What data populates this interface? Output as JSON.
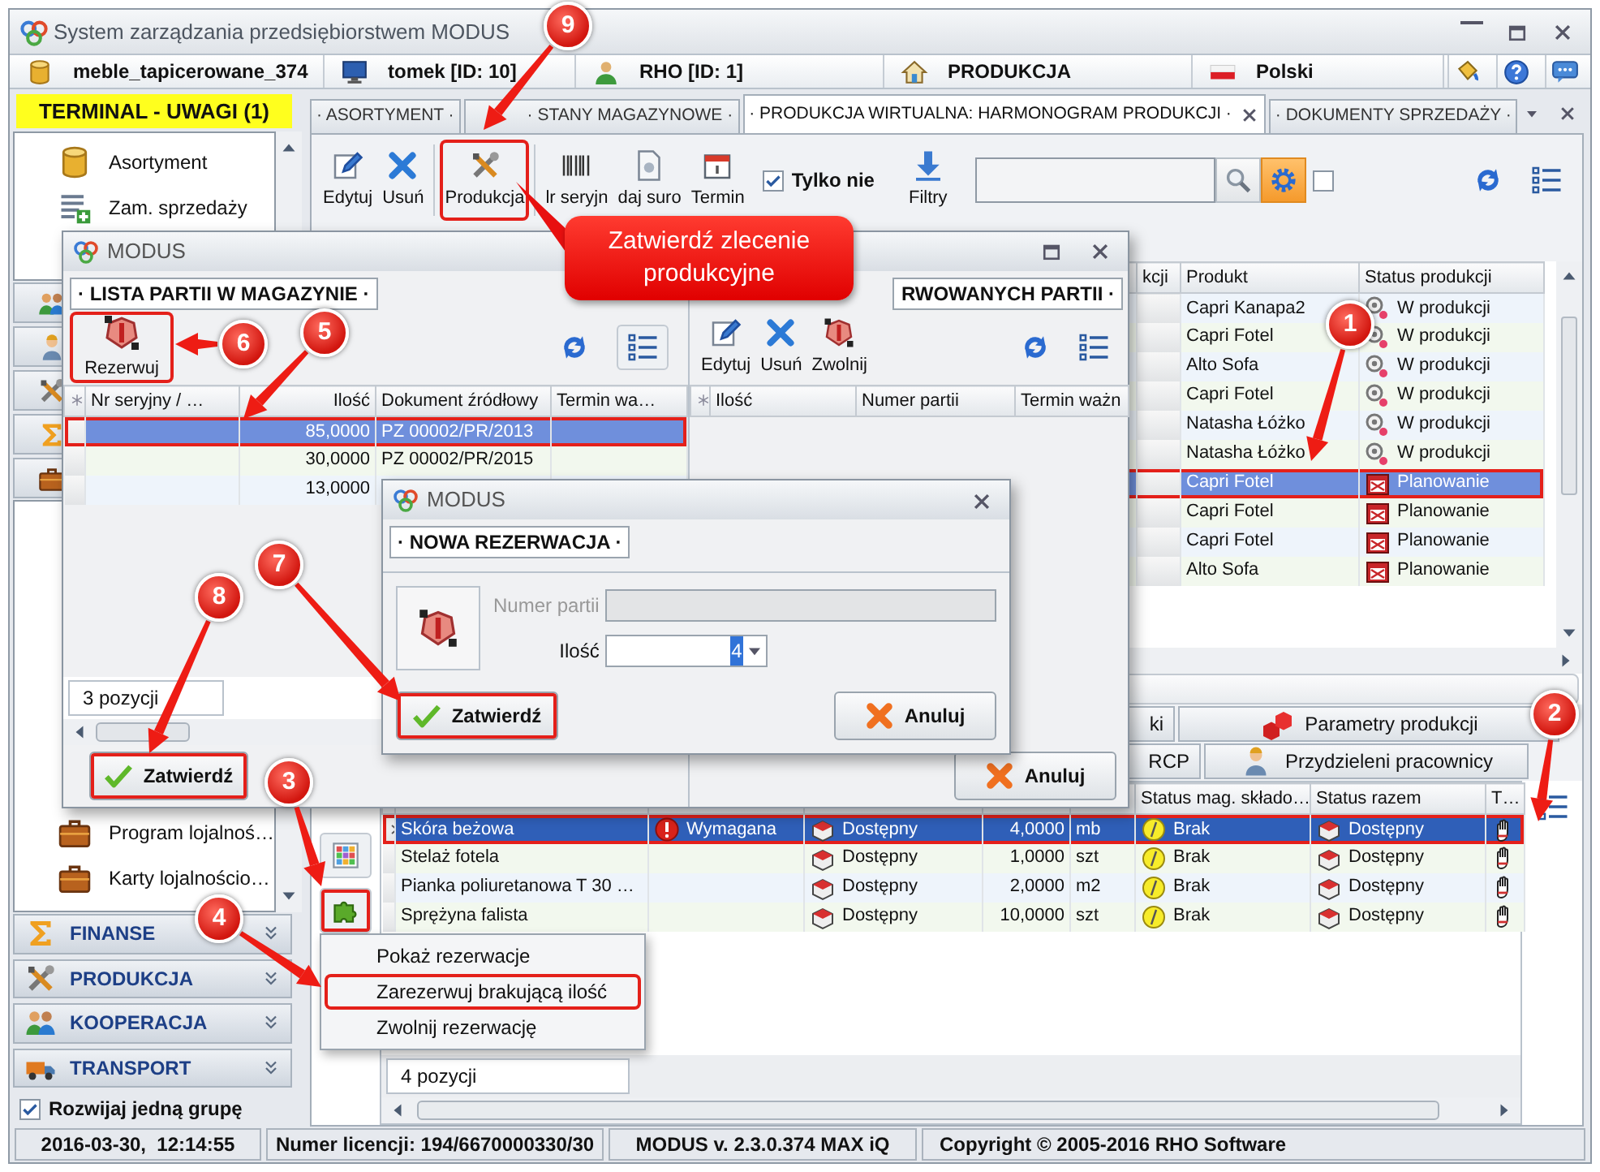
{
  "window": {
    "title": "System zarządzania przedsiębiorstwem MODUS"
  },
  "info_bar": [
    {
      "kind": "database",
      "text": "meble_tapicerowane_374"
    },
    {
      "kind": "user",
      "text": "tomek [ID: 10]"
    },
    {
      "kind": "company",
      "text": "RHO [ID: 1]"
    },
    {
      "kind": "module",
      "text": "PRODUKCJA"
    },
    {
      "kind": "language",
      "text": "Polski"
    }
  ],
  "sidebar": {
    "header": "TERMINAL - UWAGI (1)",
    "items": [
      {
        "kind": "database",
        "label": "Asortyment"
      },
      {
        "kind": "order",
        "label": "Zam. sprzedaży"
      }
    ],
    "lower_items": [
      {
        "kind": "briefcase",
        "label": "Program lojalnoś…"
      },
      {
        "kind": "briefcase",
        "label": "Karty lojalnościo…"
      }
    ],
    "groups": [
      {
        "kind": "finance",
        "label": "FINANSE"
      },
      {
        "kind": "production",
        "label": "PRODUKCJA"
      },
      {
        "kind": "cooperation",
        "label": "KOOPERACJA"
      },
      {
        "kind": "transport",
        "label": "TRANSPORT"
      }
    ],
    "expand_one_group": {
      "label": "Rozwijaj jedną grupę",
      "checked": true
    }
  },
  "tabs": [
    {
      "label": "· ASORTYMENT ·",
      "selected": false,
      "closable": false
    },
    {
      "label": "· STANY MAGAZYNOWE ·",
      "selected": false,
      "closable": false
    },
    {
      "label": "· PRODUKCJA WIRTUALNA: HARMONOGRAM PRODUKCJI ·",
      "selected": true,
      "closable": true
    },
    {
      "label": "· DOKUMENTY SPRZEDAŻY ·",
      "selected": false,
      "closable": false
    }
  ],
  "toolbar": [
    {
      "kind": "edit",
      "label": "Edytuj",
      "highlighted": false
    },
    {
      "kind": "delete",
      "label": "Usuń",
      "highlighted": false
    },
    {
      "kind": "tools",
      "label": "Produkcja",
      "highlighted": true
    },
    {
      "kind": "barcode",
      "label": "lr seryjn",
      "highlighted": false
    },
    {
      "kind": "document",
      "label": "daj suro",
      "highlighted": false
    },
    {
      "kind": "calendar",
      "label": "Termin",
      "highlighted": false
    }
  ],
  "only_unfinished": {
    "label": "Tylko nie",
    "checked": true
  },
  "filters_button": {
    "label": "Filtry"
  },
  "search_checkbox": {
    "checked": false
  },
  "production_grid": {
    "columns": [
      "kcji",
      "Produkt",
      "Status produkcji"
    ],
    "rows": [
      {
        "product": "Capri Kanapa2",
        "status": "W produkcji",
        "kind": "in_production",
        "selected": false,
        "highlighted": false
      },
      {
        "product": "Capri Fotel",
        "status": "W produkcji",
        "kind": "in_production",
        "selected": false,
        "highlighted": false
      },
      {
        "product": "Alto Sofa",
        "status": "W produkcji",
        "kind": "in_production",
        "selected": false,
        "highlighted": false
      },
      {
        "product": "Capri Fotel",
        "status": "W produkcji",
        "kind": "in_production",
        "selected": false,
        "highlighted": false
      },
      {
        "product": "Natasha Łóżko",
        "status": "W produkcji",
        "kind": "in_production",
        "selected": false,
        "highlighted": false
      },
      {
        "product": "Natasha Łóżko",
        "status": "W produkcji",
        "kind": "in_production",
        "selected": false,
        "highlighted": false
      },
      {
        "product": "Capri Fotel",
        "status": "Planowanie",
        "kind": "planning",
        "selected": true,
        "highlighted": true
      },
      {
        "product": "Capri Fotel",
        "status": "Planowanie",
        "kind": "planning",
        "selected": false,
        "highlighted": false
      },
      {
        "product": "Capri Fotel",
        "status": "Planowanie",
        "kind": "planning",
        "selected": false,
        "highlighted": false
      },
      {
        "product": "Alto Sofa",
        "status": "Planowanie",
        "kind": "planning",
        "selected": false,
        "highlighted": false
      }
    ]
  },
  "detail_tabs": [
    {
      "kind": "plain",
      "label": "ki"
    },
    {
      "kind": "parameters",
      "label": "Parametry produkcji"
    },
    {
      "kind": "plain",
      "label": "RCP"
    },
    {
      "kind": "workers",
      "label": "Przydzieleni pracownicy"
    }
  ],
  "side_tools": [
    {
      "kind": "grid",
      "highlighted": false
    },
    {
      "kind": "puzzle",
      "highlighted": true
    }
  ],
  "materials_grid": {
    "columns": [
      "Status mag. składo…",
      "Status razem",
      "T…"
    ],
    "rows": [
      {
        "name": "Skóra beżowa",
        "reservation": "Wymagana",
        "stock": "Dostępny",
        "quantity": "4,0000",
        "unit": "mb",
        "warehouse_status": "Brak",
        "total_status": "Dostępny",
        "selected": true,
        "highlighted": true
      },
      {
        "name": "Stelaż fotela",
        "stock": "Dostępny",
        "quantity": "1,0000",
        "unit": "szt",
        "warehouse_status": "Brak",
        "total_status": "Dostępny",
        "selected": false,
        "highlighted": false
      },
      {
        "name": "Pianka poliuretanowa T 30 …",
        "stock": "Dostępny",
        "quantity": "2,0000",
        "unit": "m2",
        "warehouse_status": "Brak",
        "total_status": "Dostępny",
        "selected": false,
        "highlighted": false
      },
      {
        "name": "Sprężyna falista",
        "stock": "Dostępny",
        "quantity": "10,0000",
        "unit": "szt",
        "warehouse_status": "Brak",
        "total_status": "Dostępny",
        "selected": false,
        "highlighted": false
      }
    ],
    "footer": "4 pozycji"
  },
  "context_menu": [
    {
      "label": "Pokaż rezerwacje",
      "highlighted": false
    },
    {
      "label": "Zarezerwuj brakującą ilość",
      "highlighted": true
    },
    {
      "label": "Zwolnij rezerwację",
      "highlighted": false
    }
  ],
  "batch_dialog": {
    "title": "MODUS",
    "left_tab": "· LISTA PARTII W MAGAZYNIE ·",
    "reserve_button": {
      "label": "Rezerwuj",
      "highlighted": true
    },
    "columns": [
      "Nr seryjny / …",
      "Ilość",
      "Dokument źródłowy",
      "Termin wa…"
    ],
    "rows": [
      {
        "quantity": "85,0000",
        "document": "PZ 00002/PR/2013",
        "selected": true,
        "highlighted": true
      },
      {
        "quantity": "30,0000",
        "document": "PZ 00002/PR/2015",
        "selected": false,
        "highlighted": false
      },
      {
        "quantity": "13,0000",
        "selected": false,
        "highlighted": false
      }
    ],
    "footer": "3 pozycji",
    "confirm": {
      "label": "Zatwierdź",
      "highlighted": true
    },
    "right_tab": "RWOWANYCH PARTII ·",
    "right_toolbar": [
      {
        "kind": "edit",
        "label": "Edytuj"
      },
      {
        "kind": "delete",
        "label": "Usuń"
      },
      {
        "kind": "reserve",
        "label": "Zwolnij"
      }
    ],
    "right_columns": [
      "Ilość",
      "Numer partii",
      "Termin ważn"
    ],
    "cancel": {
      "label": "Anuluj",
      "highlighted": false
    }
  },
  "reservation_dialog": {
    "title": "MODUS",
    "tab": "· NOWA REZERWACJA ·",
    "batch_field": {
      "label": "Numer partii",
      "disabled": true
    },
    "quantity_field": {
      "label": "Ilość",
      "value": "4",
      "disabled": false
    },
    "confirm": {
      "label": "Zatwierdź",
      "highlighted": true
    },
    "cancel": {
      "label": "Anuluj",
      "highlighted": false
    }
  },
  "status_bar": [
    "2016-03-30,  12:14:55",
    "Numer licencji: 194/6670000330/30",
    "MODUS v. 2.3.0.374 MAX iQ",
    "Copyright © 2005-2016 RHO Software"
  ],
  "annotations": [
    {
      "number": "1"
    },
    {
      "number": "2"
    },
    {
      "number": "3"
    },
    {
      "number": "4"
    },
    {
      "number": "5"
    },
    {
      "number": "6"
    },
    {
      "number": "7"
    },
    {
      "number": "8"
    },
    {
      "number": "9"
    }
  ],
  "callout": "Zatwierdź zlecenie produkcyjne"
}
